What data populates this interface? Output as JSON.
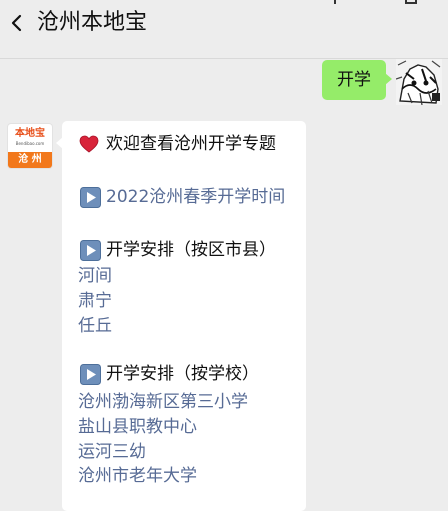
{
  "header": {
    "title": "沧州本地宝",
    "back_icon": "chevron-left-icon"
  },
  "sent_message": {
    "text": "开学"
  },
  "bot": {
    "logo_brand": "本地宝",
    "logo_url": "Bendibao.com",
    "logo_city": "沧 州"
  },
  "reply": {
    "welcome": "欢迎查看沧州开学专题",
    "welcome_icon": "red-heart-icon",
    "spring_link": "2022沧州春季开学时间",
    "by_district": {
      "heading": "开学安排（按区市县）",
      "links": [
        "河间",
        "肃宁",
        "任丘"
      ]
    },
    "by_school": {
      "heading": "开学安排（按学校）",
      "links": [
        "沧州渤海新区第三小学",
        "盐山县职教中心",
        "运河三幼",
        "沧州市老年大学"
      ]
    },
    "play_icon": "play-button-icon"
  },
  "colors": {
    "background": "#ededed",
    "sent_bubble": "#95ec69",
    "link": "#576b95",
    "logo_orange": "#f2781b"
  }
}
